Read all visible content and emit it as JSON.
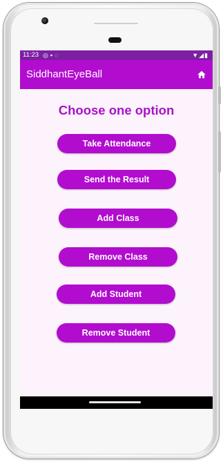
{
  "status_bar": {
    "time": "11:23",
    "left_icons": [
      "shield-icon",
      "sd-card-icon",
      "sync-icon"
    ],
    "left_glyphs": "◎▪◌",
    "right_icons": [
      "wifi-icon",
      "signal-icon",
      "battery-icon"
    ],
    "right_glyphs": "▼◢▮"
  },
  "app_bar": {
    "title": "SiddhantEyeBall",
    "home_icon": "home-icon"
  },
  "main": {
    "heading": "Choose one option",
    "buttons": [
      {
        "label": "Take Attendance"
      },
      {
        "label": "Send the Result"
      },
      {
        "label": "Add Class"
      },
      {
        "label": "Remove Class"
      },
      {
        "label": "Add Student"
      },
      {
        "label": "Remove Student"
      }
    ]
  },
  "colors": {
    "status_bar": "#7c1fa3",
    "app_bar": "#b20ccf",
    "accent_text": "#a812c7",
    "background": "#fcf3fc"
  }
}
